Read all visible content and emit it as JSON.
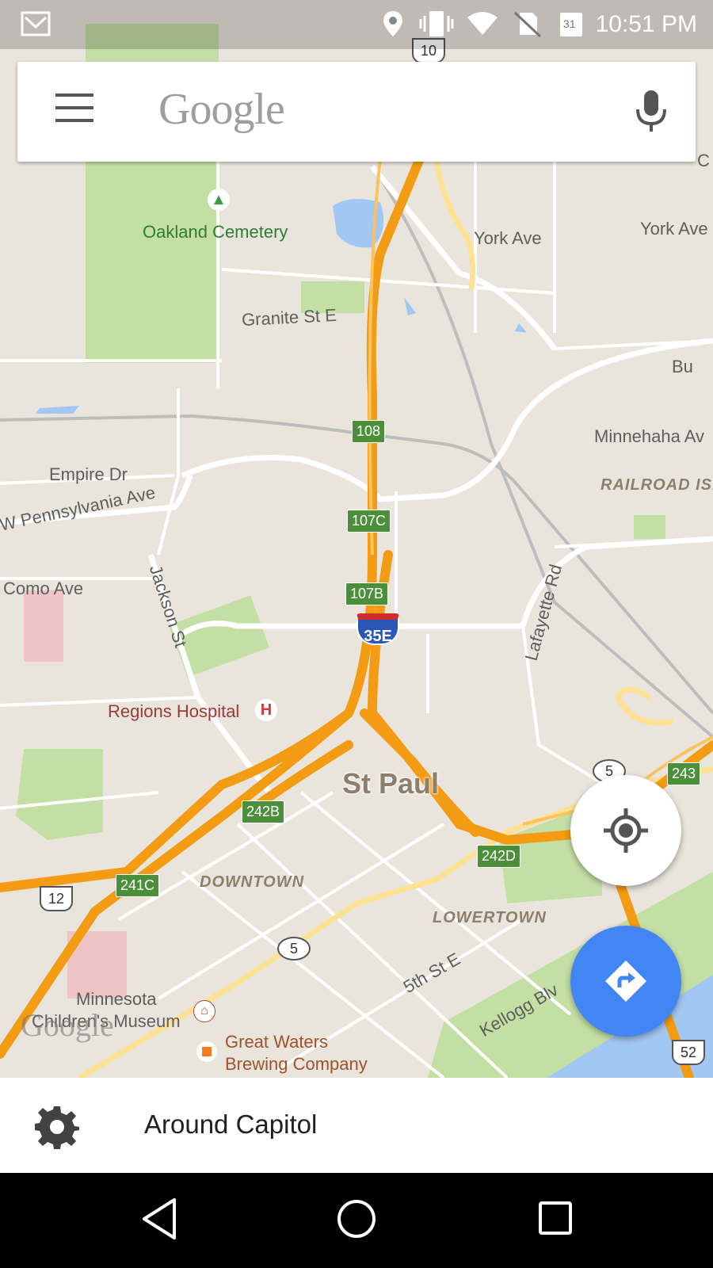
{
  "status_bar": {
    "time": "10:51 PM",
    "calendar_day": "31",
    "icons": [
      "gmail-icon",
      "location-icon",
      "vibrate-icon",
      "wifi-icon",
      "no-sim-icon",
      "calendar-icon"
    ]
  },
  "search": {
    "logo_text": "Google",
    "menu_icon": "hamburger-menu-icon",
    "mic_icon": "microphone-icon"
  },
  "map": {
    "labels": {
      "oakland_cemetery": "Oakland Cemetery",
      "york_ave_1": "York Ave",
      "york_ave_2": "York Ave",
      "granite_st": "Granite St E",
      "minnehaha": "Minnehaha Av",
      "railroad": "RAILROAD ISL",
      "empire_dr": "Empire Dr",
      "pennsylvania": "W Pennsylvania Ave",
      "como": "Como Ave",
      "jackson": "Jackson St",
      "lafayette": "Lafayette Rd",
      "regions": "Regions Hospital",
      "st_paul": "St Paul",
      "downtown": "DOWNTOWN",
      "lowertown": "LOWERTOWN",
      "fifth_st": "5th St E",
      "kellogg": "Kellogg Blv",
      "mn_childrens_1": "Minnesota",
      "mn_childrens_2": "Children's Museum",
      "great_waters_1": "Great Waters",
      "great_waters_2": "Brewing Company",
      "bu": "Bu",
      "c_edge": "C",
      "watermark": "Google"
    },
    "exits": [
      "108",
      "107C",
      "107B",
      "242B",
      "241C",
      "242D",
      "243"
    ],
    "shields": {
      "us10": "10",
      "us12": "12",
      "us52": "52",
      "mn5_a": "5",
      "mn5_b": "5",
      "i35e": "35E"
    },
    "colors": {
      "land": "#e9e5dc",
      "park": "#c4dfa4",
      "water": "#a3c7f3",
      "freeway": "#f6a21b",
      "arterial": "#fde293",
      "road": "#ffffff"
    }
  },
  "fab": {
    "locate_icon": "my-location-icon",
    "directions_icon": "directions-icon"
  },
  "bottom_sheet": {
    "icon": "gear-icon",
    "label": "Around Capitol"
  },
  "nav_bar": {
    "back_icon": "back-icon",
    "home_icon": "home-icon",
    "recents_icon": "recents-icon"
  }
}
